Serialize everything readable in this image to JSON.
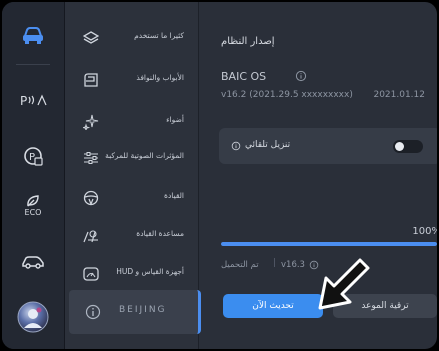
{
  "menu": {
    "items": [
      {
        "label": "كثيرا ما تستخدم",
        "icon": "layers-icon"
      },
      {
        "label": "الأبواب والنوافذ",
        "icon": "car-window-icon"
      },
      {
        "label": "أضواء",
        "icon": "sparkle-light-icon"
      },
      {
        "label": "المؤثرات الصوتية للمركبة",
        "icon": "sliders-icon"
      },
      {
        "label": "القيادة",
        "icon": "steering-wheel-icon"
      },
      {
        "label": "مساعدة القيادة",
        "icon": "driver-assist-icon"
      },
      {
        "label": "أجهزة القياس و HUD",
        "icon": "gauge-icon"
      }
    ],
    "active_label": "BEIJING"
  },
  "rail": {
    "eco_label": "ECO",
    "icons": [
      "car-icon",
      "park-assist-icon",
      "parking-camera-icon",
      "eco-leaf-icon",
      "car-outline-icon",
      "user-avatar"
    ]
  },
  "main": {
    "section_title": "إصدار النظام",
    "os_name": "BAIC OS",
    "os_version": "v16.2 (2021.29.5 xxxxxxxxx)",
    "os_date": "2021.01.12",
    "auto_download_label": "تنزيل تلقائي",
    "auto_download_enabled": false,
    "progress_percent": 100,
    "progress_label": "100%",
    "download_status": "تم التحميل",
    "download_version": "v16.3",
    "update_now_label": "تحديث الآن",
    "schedule_label": "ترقية الموعد"
  },
  "colors": {
    "accent": "#4b8ef0",
    "primary_button": "#3b8def",
    "background": "#2a2f39"
  }
}
